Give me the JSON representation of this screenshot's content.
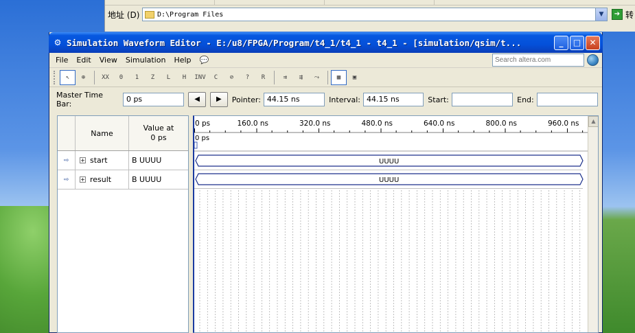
{
  "explorer": {
    "address_label": "地址 (D)",
    "address_value": "D:\\Program Files",
    "go_label": "转"
  },
  "window": {
    "title": "Simulation Waveform Editor - E:/u8/FPGA/Program/t4_1/t4_1 - t4_1 - [simulation/qsim/t...",
    "buttons": {
      "minimize": "_",
      "maximize": "□",
      "close": "✕"
    }
  },
  "menu": {
    "items": [
      "File",
      "Edit",
      "View",
      "Simulation",
      "Help"
    ],
    "search_placeholder": "Search altera.com"
  },
  "toolbar": {
    "tools": [
      "select",
      "zoom",
      "X",
      "0",
      "1",
      "Z",
      "L",
      "H",
      "INV",
      "C",
      "O",
      "?",
      "R",
      "arrows-1",
      "arrows-2",
      "arrows-3",
      "snap",
      "grid"
    ]
  },
  "timebar": {
    "master_label": "Master Time Bar:",
    "master_value": "0 ps",
    "prev": "◀",
    "next": "▶",
    "pointer_label": "Pointer:",
    "pointer_value": "44.15 ns",
    "interval_label": "Interval:",
    "interval_value": "44.15 ns",
    "start_label": "Start:",
    "start_value": "",
    "end_label": "End:",
    "end_value": ""
  },
  "signals": {
    "header_name": "Name",
    "header_value_line1": "Value at",
    "header_value_line2": "0 ps",
    "rows": [
      {
        "name": "start",
        "value": "B UUUU",
        "wave": "UUUU"
      },
      {
        "name": "result",
        "value": "B UUUU",
        "wave": "UUUU"
      }
    ]
  },
  "timeline": {
    "ticks": [
      "0 ps",
      "160.0 ns",
      "320.0 ns",
      "480.0 ns",
      "640.0 ns",
      "800.0 ns",
      "960.0 ns"
    ],
    "marker_label": "0 ps"
  },
  "colors": {
    "title_blue": "#0450d9",
    "wave_blue": "#1a2f8a",
    "grid": "#9a9a9a"
  }
}
